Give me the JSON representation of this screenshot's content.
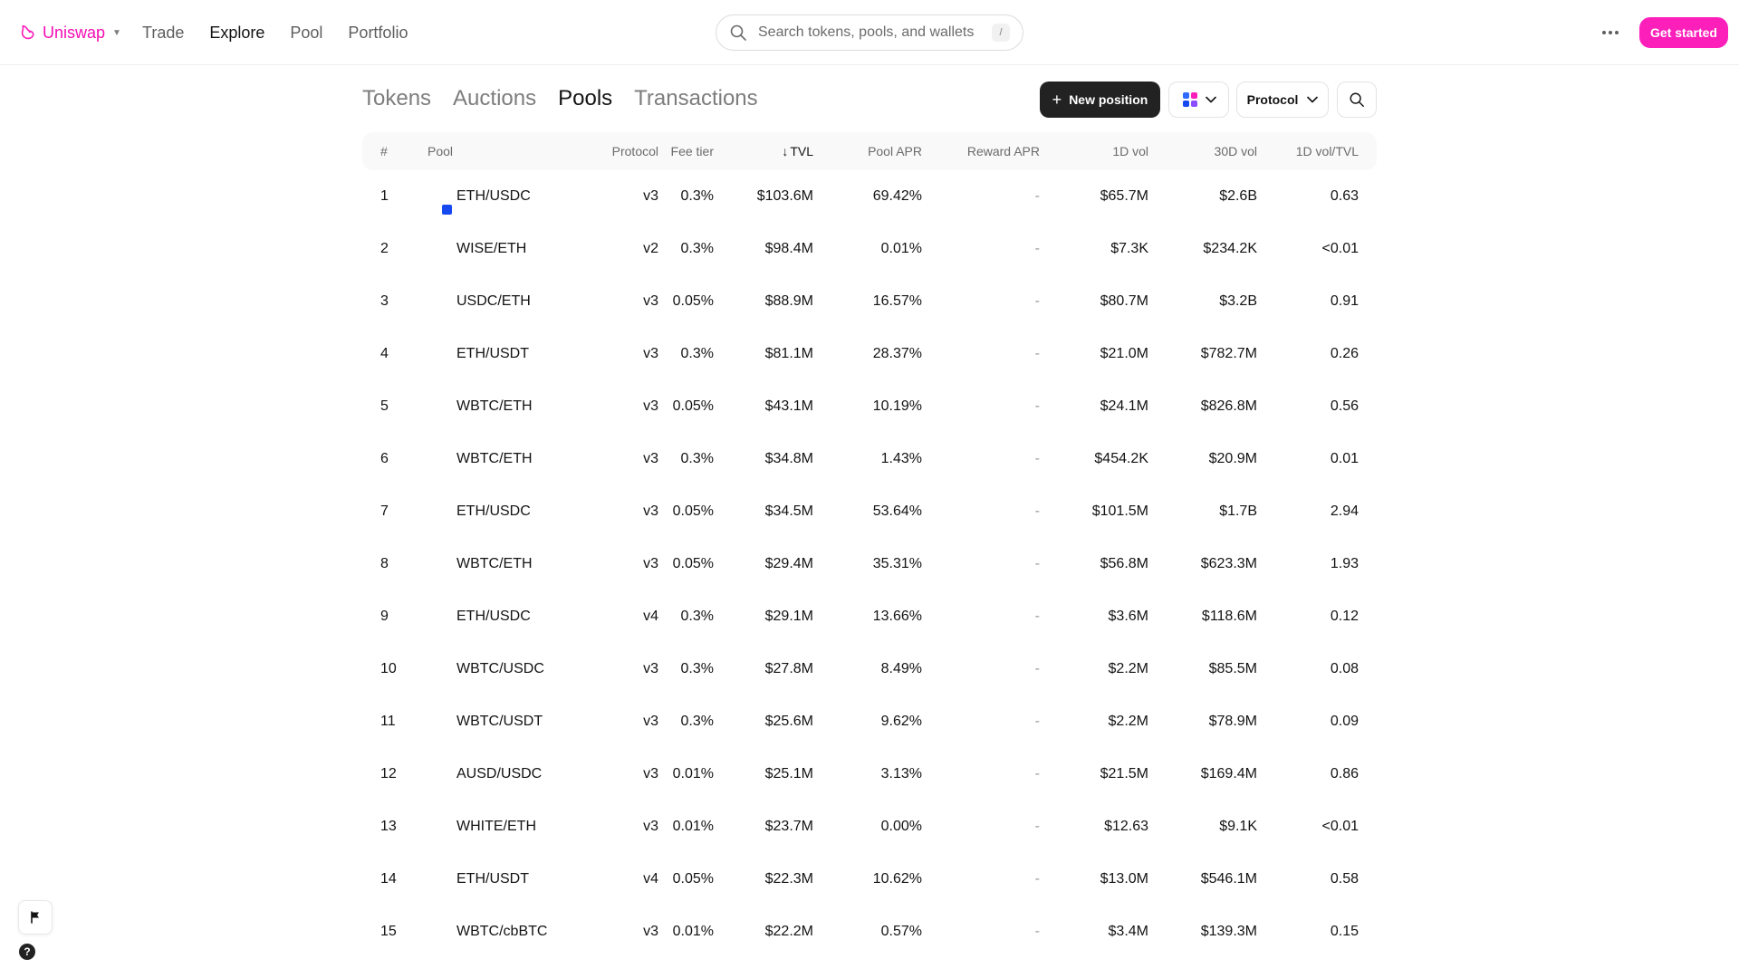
{
  "nav": {
    "brand": "Uniswap",
    "links": [
      "Trade",
      "Explore",
      "Pool",
      "Portfolio"
    ],
    "active_link": "Explore",
    "search_placeholder": "Search tokens, pools, and wallets",
    "search_shortcut": "/",
    "get_started": "Get started"
  },
  "explore": {
    "tabs": [
      "Tokens",
      "Auctions",
      "Pools",
      "Transactions"
    ],
    "active_tab": "Pools",
    "new_position": "New position",
    "protocol_filter": "Protocol"
  },
  "table": {
    "headers": {
      "num": "#",
      "pool": "Pool",
      "protocol": "Protocol",
      "fee": "Fee tier",
      "tvl": "TVL",
      "apr": "Pool APR",
      "reward": "Reward APR",
      "vol1d": "1D vol",
      "vol30d": "30D vol",
      "ratio": "1D vol/TVL"
    },
    "sort_column": "TVL",
    "rows": [
      {
        "num": "1",
        "pool": "ETH/USDC",
        "protocol": "v3",
        "fee": "0.3%",
        "tvl": "$103.6M",
        "apr": "69.42%",
        "reward": "-",
        "vol1d": "$65.7M",
        "vol30d": "$2.6B",
        "ratio": "0.63"
      },
      {
        "num": "2",
        "pool": "WISE/ETH",
        "protocol": "v2",
        "fee": "0.3%",
        "tvl": "$98.4M",
        "apr": "0.01%",
        "reward": "-",
        "vol1d": "$7.3K",
        "vol30d": "$234.2K",
        "ratio": "<0.01"
      },
      {
        "num": "3",
        "pool": "USDC/ETH",
        "protocol": "v3",
        "fee": "0.05%",
        "tvl": "$88.9M",
        "apr": "16.57%",
        "reward": "-",
        "vol1d": "$80.7M",
        "vol30d": "$3.2B",
        "ratio": "0.91"
      },
      {
        "num": "4",
        "pool": "ETH/USDT",
        "protocol": "v3",
        "fee": "0.3%",
        "tvl": "$81.1M",
        "apr": "28.37%",
        "reward": "-",
        "vol1d": "$21.0M",
        "vol30d": "$782.7M",
        "ratio": "0.26"
      },
      {
        "num": "5",
        "pool": "WBTC/ETH",
        "protocol": "v3",
        "fee": "0.05%",
        "tvl": "$43.1M",
        "apr": "10.19%",
        "reward": "-",
        "vol1d": "$24.1M",
        "vol30d": "$826.8M",
        "ratio": "0.56"
      },
      {
        "num": "6",
        "pool": "WBTC/ETH",
        "protocol": "v3",
        "fee": "0.3%",
        "tvl": "$34.8M",
        "apr": "1.43%",
        "reward": "-",
        "vol1d": "$454.2K",
        "vol30d": "$20.9M",
        "ratio": "0.01"
      },
      {
        "num": "7",
        "pool": "ETH/USDC",
        "protocol": "v3",
        "fee": "0.05%",
        "tvl": "$34.5M",
        "apr": "53.64%",
        "reward": "-",
        "vol1d": "$101.5M",
        "vol30d": "$1.7B",
        "ratio": "2.94"
      },
      {
        "num": "8",
        "pool": "WBTC/ETH",
        "protocol": "v3",
        "fee": "0.05%",
        "tvl": "$29.4M",
        "apr": "35.31%",
        "reward": "-",
        "vol1d": "$56.8M",
        "vol30d": "$623.3M",
        "ratio": "1.93"
      },
      {
        "num": "9",
        "pool": "ETH/USDC",
        "protocol": "v4",
        "fee": "0.3%",
        "tvl": "$29.1M",
        "apr": "13.66%",
        "reward": "-",
        "vol1d": "$3.6M",
        "vol30d": "$118.6M",
        "ratio": "0.12"
      },
      {
        "num": "10",
        "pool": "WBTC/USDC",
        "protocol": "v3",
        "fee": "0.3%",
        "tvl": "$27.8M",
        "apr": "8.49%",
        "reward": "-",
        "vol1d": "$2.2M",
        "vol30d": "$85.5M",
        "ratio": "0.08"
      },
      {
        "num": "11",
        "pool": "WBTC/USDT",
        "protocol": "v3",
        "fee": "0.3%",
        "tvl": "$25.6M",
        "apr": "9.62%",
        "reward": "-",
        "vol1d": "$2.2M",
        "vol30d": "$78.9M",
        "ratio": "0.09"
      },
      {
        "num": "12",
        "pool": "AUSD/USDC",
        "protocol": "v3",
        "fee": "0.01%",
        "tvl": "$25.1M",
        "apr": "3.13%",
        "reward": "-",
        "vol1d": "$21.5M",
        "vol30d": "$169.4M",
        "ratio": "0.86"
      },
      {
        "num": "13",
        "pool": "WHITE/ETH",
        "protocol": "v3",
        "fee": "0.01%",
        "tvl": "$23.7M",
        "apr": "0.00%",
        "reward": "-",
        "vol1d": "$12.63",
        "vol30d": "$9.1K",
        "ratio": "<0.01"
      },
      {
        "num": "14",
        "pool": "ETH/USDT",
        "protocol": "v4",
        "fee": "0.05%",
        "tvl": "$22.3M",
        "apr": "10.62%",
        "reward": "-",
        "vol1d": "$13.0M",
        "vol30d": "$546.1M",
        "ratio": "0.58"
      },
      {
        "num": "15",
        "pool": "WBTC/cbBTC",
        "protocol": "v3",
        "fee": "0.01%",
        "tvl": "$22.2M",
        "apr": "0.57%",
        "reward": "-",
        "vol1d": "$3.4M",
        "vol30d": "$139.3M",
        "ratio": "0.15"
      }
    ]
  },
  "widgets": {
    "help": "?"
  },
  "colors": {
    "brand": "#fc1fba",
    "text_primary": "#131313",
    "text_secondary": "#6b6b6b",
    "header_bg": "#f9f9f9",
    "chain_blue": "#1649f0"
  },
  "icons": [
    "uniswap-logo-icon",
    "search-icon",
    "more-dots-icon",
    "plus-icon",
    "chain-grid-icon",
    "chevron-down-icon",
    "sort-arrow-down-icon",
    "flag-icon",
    "help-icon"
  ]
}
